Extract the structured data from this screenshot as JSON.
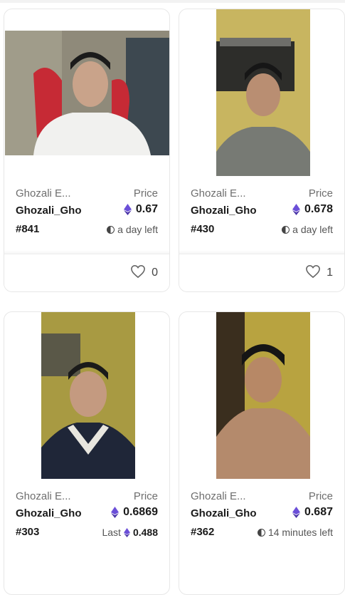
{
  "cards": [
    {
      "collection": "Ghozali E...",
      "name": "Ghozali_Gho",
      "token_id": "#841",
      "price_label": "Price",
      "price": "0.67",
      "meta_text": "a day left",
      "meta_icon": "clock-icon",
      "likes": "0"
    },
    {
      "collection": "Ghozali E...",
      "name": "Ghozali_Gho",
      "token_id": "#430",
      "price_label": "Price",
      "price": "0.678",
      "meta_text": "a day left",
      "meta_icon": "clock-icon",
      "likes": "1"
    },
    {
      "collection": "Ghozali E...",
      "name": "Ghozali_Gho",
      "token_id": "#303",
      "price_label": "Price",
      "price": "0.6869",
      "meta_label": "Last",
      "meta_text": "0.488",
      "meta_icon": "eth-icon"
    },
    {
      "collection": "Ghozali E...",
      "name": "Ghozali_Gho",
      "token_id": "#362",
      "price_label": "Price",
      "price": "0.687",
      "meta_text": "14 minutes left",
      "meta_icon": "clock-icon"
    }
  ],
  "colors": {
    "eth_purple": "#6b4fd8",
    "text_muted": "#6e6e6e",
    "border": "#e7e7e7"
  }
}
